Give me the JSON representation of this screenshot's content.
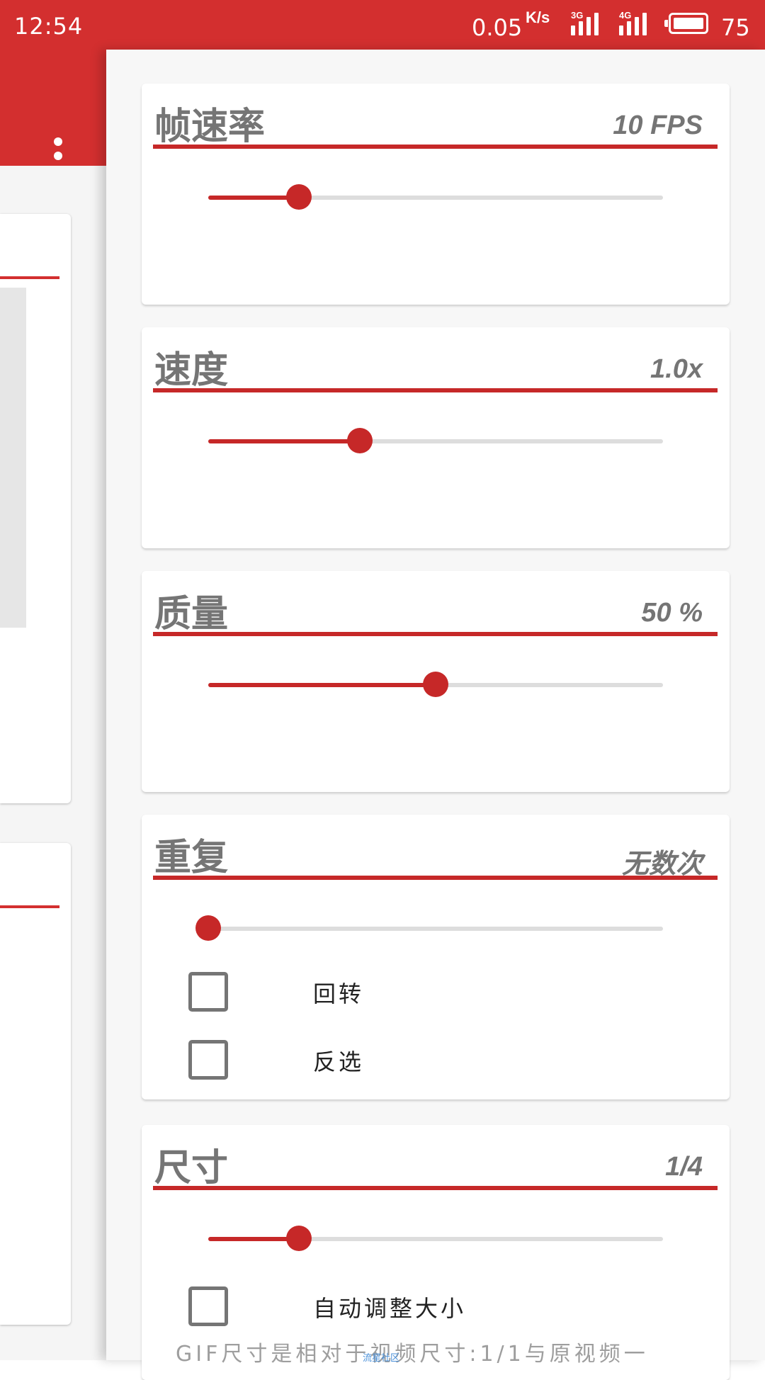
{
  "status_bar": {
    "time": "12:54",
    "net_speed": "0.05",
    "net_unit": "K/s",
    "signal_1_label": "3G",
    "signal_2_label": "4G",
    "battery": "75",
    "background_color": "#d32f2f"
  },
  "icons": {
    "overflow_menu": "more-vert-icon",
    "battery": "battery-icon",
    "signal": "cell-signal-icon"
  },
  "settings": {
    "frame_rate": {
      "title": "帧速率",
      "value": "10 FPS",
      "slider_fraction": 0.2
    },
    "speed": {
      "title": "速度",
      "value": "1.0x",
      "slider_fraction": 0.333
    },
    "quality": {
      "title": "质量",
      "value": "50 %",
      "slider_fraction": 0.5
    },
    "repeat": {
      "title": "重复",
      "value": "无数次",
      "slider_fraction": 0.0,
      "option_rotate": {
        "label": "回转",
        "checked": false
      },
      "option_reverse": {
        "label": "反选",
        "checked": false
      }
    },
    "size": {
      "title": "尺寸",
      "value": "1/4",
      "slider_fraction": 0.2,
      "option_auto_resize": {
        "label": "自动调整大小",
        "checked": false
      }
    }
  },
  "footer": {
    "hint": "GIF尺寸是相对于视频尺寸:1/1与原视频一",
    "watermark": "流星社区"
  },
  "colors": {
    "accent": "#c62828",
    "title_text": "#757575",
    "card_bg": "#ffffff",
    "panel_bg": "#f7f7f7"
  }
}
